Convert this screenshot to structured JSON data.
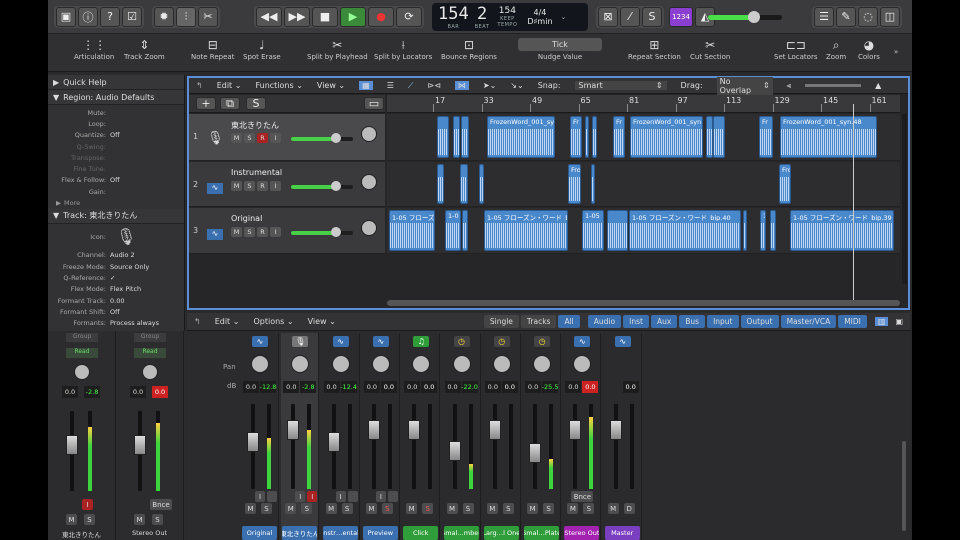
{
  "control_bar": {
    "lcd": {
      "bar_value": "154",
      "beat_value": "2",
      "bar_label": "BAR",
      "beat_label": "BEAT",
      "tempo_value": "154",
      "tempo_keep": "KEEP",
      "tempo_label": "TEMPO",
      "time_signature": "4/4",
      "key": "D♯min"
    },
    "count_in": "1234",
    "master_volume": 0.62
  },
  "toolbar": {
    "items": [
      "Articulation",
      "Track Zoom",
      "Note Repeat",
      "Spot Erase",
      "Split by Playhead",
      "Split by Locators",
      "Bounce Regions",
      "Nudge Value",
      "Repeat Section",
      "Cut Section",
      "Set Locators",
      "Zoom",
      "Colors"
    ],
    "nudge_value": "Tick"
  },
  "inspector": {
    "quick_help": "Quick Help",
    "region_header": "Region: Audio Defaults",
    "region_rows": [
      {
        "k": "Mute:",
        "v": ""
      },
      {
        "k": "Loop:",
        "v": ""
      },
      {
        "k": "Quantize:",
        "v": "Off"
      },
      {
        "k": "Q-Swing:",
        "v": ""
      },
      {
        "k": "Transpose:",
        "v": ""
      },
      {
        "k": "Fine Tune:",
        "v": ""
      },
      {
        "k": "Flex & Follow:",
        "v": "Off"
      },
      {
        "k": "Gain:",
        "v": ""
      }
    ],
    "more": "More",
    "track_header": "Track: 東北きりたん",
    "icon_label": "Icon:",
    "track_rows": [
      {
        "k": "Channel:",
        "v": "Audio 2"
      },
      {
        "k": "Freeze Mode:",
        "v": "Source Only"
      },
      {
        "k": "Q-Reference:",
        "v": "✓"
      },
      {
        "k": "Flex Mode:",
        "v": "Flex Pitch"
      },
      {
        "k": "Formant Track:",
        "v": "0.00"
      },
      {
        "k": "Formant Shift:",
        "v": "Off"
      },
      {
        "k": "Formants:",
        "v": "Process always"
      }
    ],
    "strips": [
      {
        "group": "Group",
        "auto": "Read",
        "pan": "0.0",
        "db": "-2.8",
        "name": "東北きりたん",
        "btn": "I"
      },
      {
        "group": "Group",
        "auto": "Read",
        "pan": "0.0",
        "db": "0.0",
        "name": "Stereo Out",
        "btn": "Bnce"
      }
    ]
  },
  "tracks_area": {
    "menus": [
      "Edit",
      "Functions",
      "View"
    ],
    "snap_label": "Snap:",
    "snap_value": "Smart",
    "drag_label": "Drag:",
    "drag_value": "No Overlap",
    "ruler": [
      "17",
      "33",
      "49",
      "65",
      "81",
      "97",
      "113",
      "129",
      "145",
      "161"
    ],
    "tracks": [
      {
        "num": "1",
        "name": "東北きりたん",
        "vol": 0.72
      },
      {
        "num": "2",
        "name": "Instrumental",
        "vol": 0.72
      },
      {
        "num": "3",
        "name": "Original",
        "vol": 0.72
      }
    ],
    "regions": {
      "t1": [
        "FrozenWord_001_sy",
        "Fr",
        "Fr",
        "FrozenWord_001_syn",
        "Fr",
        "FrozenWord_001_syn.48"
      ],
      "t2": [
        "Fro",
        "Fro"
      ],
      "t3": [
        "1-05 フローズ",
        "1-0",
        "1-05 フローズン・ワード_b",
        "1-05",
        "1-05 フローズン・ワード_bip.40",
        "1-",
        "1-05 フローズン・ワード_bip.39"
      ]
    }
  },
  "mixer": {
    "menus": [
      "Edit",
      "Options",
      "View"
    ],
    "view_tabs": [
      "Single",
      "Tracks",
      "All"
    ],
    "filter_tabs": [
      "Audio",
      "Inst",
      "Aux",
      "Bus",
      "Input",
      "Output",
      "Master/VCA",
      "MIDI"
    ],
    "pan_label": "Pan",
    "db_label": "dB",
    "strips": [
      {
        "name": "Original",
        "pan": "0.0",
        "db": "-12.8",
        "color": "#3a6fb0",
        "fader": 0.55,
        "meter": 0.6,
        "icon": "wave",
        "rec": "I",
        "sub": "R"
      },
      {
        "name": "東北きりたん",
        "pan": "0.0",
        "db": "-2.8",
        "color": "#3a6fb0",
        "fader": 0.7,
        "meter": 0.7,
        "icon": "mic",
        "rec": "I",
        "sub": "R"
      },
      {
        "name": "Instr…ental",
        "pan": "0.0",
        "db": "-12.4",
        "color": "#3a6fb0",
        "fader": 0.55,
        "meter": 0.0,
        "icon": "wave",
        "rec": "I",
        "sub": "R"
      },
      {
        "name": "Preview",
        "pan": "0.0",
        "db": "0.0",
        "color": "#3a6fb0",
        "fader": 0.7,
        "meter": 0.0,
        "icon": "wave",
        "rec": "I",
        "sub": "R"
      },
      {
        "name": "Click",
        "pan": "0.0",
        "db": "0.0",
        "color": "#2f9e3a",
        "fader": 0.7,
        "meter": 0.0,
        "icon": "note",
        "rec": "",
        "sub": ""
      },
      {
        "name": "Smal…mber",
        "pan": "0.0",
        "db": "-22.0",
        "color": "#2f9e3a",
        "fader": 0.45,
        "meter": 0.3,
        "icon": "dial",
        "rec": "",
        "sub": ""
      },
      {
        "name": "Larg…l One",
        "pan": "0.0",
        "db": "0.0",
        "color": "#2f9e3a",
        "fader": 0.7,
        "meter": 0.0,
        "icon": "dial",
        "rec": "",
        "sub": ""
      },
      {
        "name": "Smal…Plate",
        "pan": "0.0",
        "db": "-25.5",
        "color": "#2f9e3a",
        "fader": 0.42,
        "meter": 0.35,
        "icon": "dial",
        "rec": "",
        "sub": ""
      },
      {
        "name": "Stereo Out",
        "pan": "0.0",
        "db": "0.0",
        "color": "#a323b0",
        "fader": 0.7,
        "meter": 0.85,
        "icon": "wave",
        "rec": "Bnce",
        "sub": ""
      },
      {
        "name": "Master",
        "pan": "",
        "db": "0.0",
        "color": "#7a3fc0",
        "fader": 0.7,
        "meter": 0.0,
        "icon": "wave",
        "rec": "",
        "sub": ""
      }
    ]
  }
}
